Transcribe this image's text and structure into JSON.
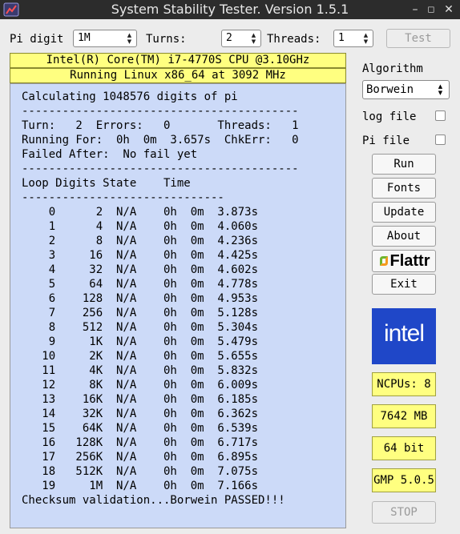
{
  "window": {
    "title": "System Stability Tester. Version 1.5.1",
    "minimize": "–",
    "maximize": "◻",
    "close": "✕"
  },
  "controls": {
    "pi_digit_label": "Pi digit",
    "pi_digit_value": "1M",
    "turns_label": "Turns:",
    "turns_value": "2",
    "threads_label": "Threads:",
    "threads_value": "1",
    "test_button": "Test"
  },
  "cpu_info": "Intel(R) Core(TM) i7-4770S CPU @3.10GHz",
  "os_info": "Running Linux x86_64 at 3092 MHz",
  "output": {
    "header_lines": [
      "Calculating 1048576 digits of pi",
      "-----------------------------------------",
      "Turn:   2  Errors:   0       Threads:   1",
      "Running For:  0h  0m  3.657s  ChkErr:   0",
      "Failed After:  No fail yet",
      "-----------------------------------------",
      "Loop Digits State    Time",
      "------------------------------"
    ],
    "columns": [
      "Loop",
      "Digits",
      "State",
      "Time"
    ],
    "rows": [
      {
        "loop": "0",
        "digits": "2",
        "state": "N/A",
        "time": "0h  0m  3.873s"
      },
      {
        "loop": "1",
        "digits": "4",
        "state": "N/A",
        "time": "0h  0m  4.060s"
      },
      {
        "loop": "2",
        "digits": "8",
        "state": "N/A",
        "time": "0h  0m  4.236s"
      },
      {
        "loop": "3",
        "digits": "16",
        "state": "N/A",
        "time": "0h  0m  4.425s"
      },
      {
        "loop": "4",
        "digits": "32",
        "state": "N/A",
        "time": "0h  0m  4.602s"
      },
      {
        "loop": "5",
        "digits": "64",
        "state": "N/A",
        "time": "0h  0m  4.778s"
      },
      {
        "loop": "6",
        "digits": "128",
        "state": "N/A",
        "time": "0h  0m  4.953s"
      },
      {
        "loop": "7",
        "digits": "256",
        "state": "N/A",
        "time": "0h  0m  5.128s"
      },
      {
        "loop": "8",
        "digits": "512",
        "state": "N/A",
        "time": "0h  0m  5.304s"
      },
      {
        "loop": "9",
        "digits": "1K",
        "state": "N/A",
        "time": "0h  0m  5.479s"
      },
      {
        "loop": "10",
        "digits": "2K",
        "state": "N/A",
        "time": "0h  0m  5.655s"
      },
      {
        "loop": "11",
        "digits": "4K",
        "state": "N/A",
        "time": "0h  0m  5.832s"
      },
      {
        "loop": "12",
        "digits": "8K",
        "state": "N/A",
        "time": "0h  0m  6.009s"
      },
      {
        "loop": "13",
        "digits": "16K",
        "state": "N/A",
        "time": "0h  0m  6.185s"
      },
      {
        "loop": "14",
        "digits": "32K",
        "state": "N/A",
        "time": "0h  0m  6.362s"
      },
      {
        "loop": "15",
        "digits": "64K",
        "state": "N/A",
        "time": "0h  0m  6.539s"
      },
      {
        "loop": "16",
        "digits": "128K",
        "state": "N/A",
        "time": "0h  0m  6.717s"
      },
      {
        "loop": "17",
        "digits": "256K",
        "state": "N/A",
        "time": "0h  0m  6.895s"
      },
      {
        "loop": "18",
        "digits": "512K",
        "state": "N/A",
        "time": "0h  0m  7.075s"
      },
      {
        "loop": "19",
        "digits": "1M",
        "state": "N/A",
        "time": "0h  0m  7.166s"
      }
    ],
    "footer": "Checksum validation...Borwein PASSED!!!"
  },
  "sidebar": {
    "algorithm_label": "Algorithm",
    "algorithm_value": "Borwein",
    "log_file_label": "log file",
    "pi_file_label": "Pi file",
    "run_button": "Run",
    "fonts_button": "Fonts",
    "update_button": "Update",
    "about_button": "About",
    "flattr_button": "Flattr",
    "exit_button": "Exit",
    "logo_text": "intel",
    "ncpus": "NCPUs: 8",
    "memory": "7642 MB",
    "bits": "64 bit",
    "gmp": "GMP 5.0.5",
    "stop_button": "STOP"
  },
  "colors": {
    "titlebar": "#2c2c2c",
    "output_bg": "#ccdaf8",
    "info_yellow": "#ffff80",
    "intel_blue": "#1f47c8",
    "flattr_green": "#6fb52c",
    "flattr_orange": "#f59a1c"
  },
  "icons": {
    "app": "app-icon",
    "flattr": "flattr-icon",
    "spin_arrows": "spin-arrows-icon"
  }
}
